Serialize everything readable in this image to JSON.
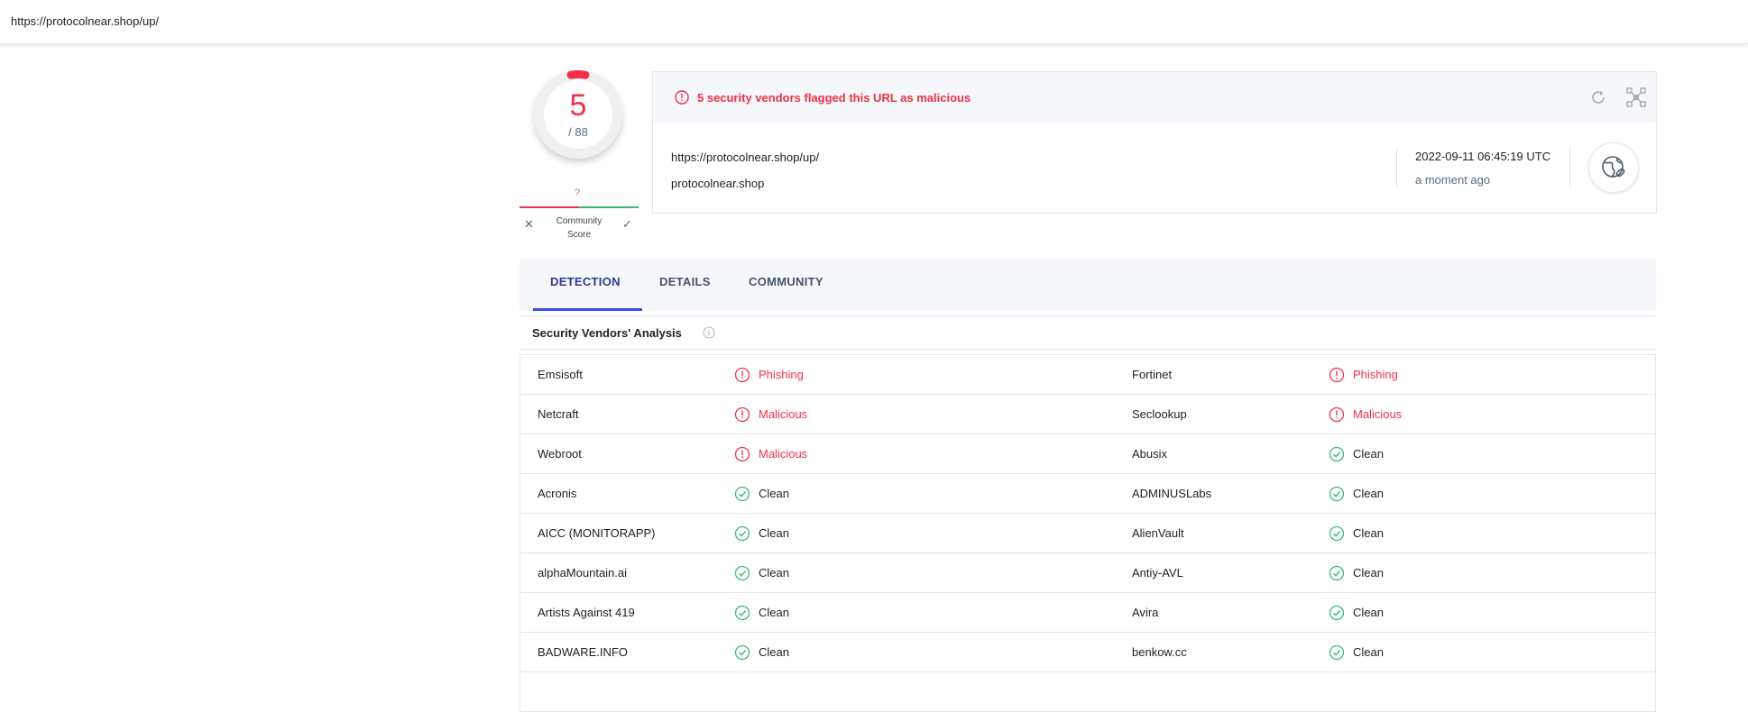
{
  "browser": {
    "url": "https://protocolnear.shop/up/"
  },
  "score": {
    "detections": "5",
    "total": "/ 88",
    "fraction": 0.0568
  },
  "community": {
    "unknown": "?",
    "label_line1": "Community",
    "label_line2": "Score"
  },
  "summary": {
    "alert": "5 security vendors flagged this URL as malicious",
    "url": "https://protocolnear.shop/up/",
    "domain": "protocolnear.shop",
    "date": "2022-09-11 06:45:19 UTC",
    "ago": "a moment ago"
  },
  "tabs": [
    {
      "label": "DETECTION",
      "active": true
    },
    {
      "label": "DETAILS",
      "active": false
    },
    {
      "label": "COMMUNITY",
      "active": false
    }
  ],
  "section": {
    "title": "Security Vendors' Analysis"
  },
  "colors": {
    "malicious": "#f0304a",
    "clean": "#3ab877",
    "tab_active": "#3d4de0"
  },
  "vendors": [
    [
      {
        "name": "Emsisoft",
        "result": "Phishing",
        "status": "bad"
      },
      {
        "name": "Fortinet",
        "result": "Phishing",
        "status": "bad"
      }
    ],
    [
      {
        "name": "Netcraft",
        "result": "Malicious",
        "status": "bad"
      },
      {
        "name": "Seclookup",
        "result": "Malicious",
        "status": "bad"
      }
    ],
    [
      {
        "name": "Webroot",
        "result": "Malicious",
        "status": "bad"
      },
      {
        "name": "Abusix",
        "result": "Clean",
        "status": "good"
      }
    ],
    [
      {
        "name": "Acronis",
        "result": "Clean",
        "status": "good"
      },
      {
        "name": "ADMINUSLabs",
        "result": "Clean",
        "status": "good"
      }
    ],
    [
      {
        "name": "AICC (MONITORAPP)",
        "result": "Clean",
        "status": "good"
      },
      {
        "name": "AlienVault",
        "result": "Clean",
        "status": "good"
      }
    ],
    [
      {
        "name": "alphaMountain.ai",
        "result": "Clean",
        "status": "good"
      },
      {
        "name": "Antiy-AVL",
        "result": "Clean",
        "status": "good"
      }
    ],
    [
      {
        "name": "Artists Against 419",
        "result": "Clean",
        "status": "good"
      },
      {
        "name": "Avira",
        "result": "Clean",
        "status": "good"
      }
    ],
    [
      {
        "name": "BADWARE.INFO",
        "result": "Clean",
        "status": "good"
      },
      {
        "name": "benkow.cc",
        "result": "Clean",
        "status": "good"
      }
    ],
    [
      {
        "name": "",
        "result": "",
        "status": "good"
      },
      {
        "name": "",
        "result": "",
        "status": "good"
      }
    ]
  ]
}
